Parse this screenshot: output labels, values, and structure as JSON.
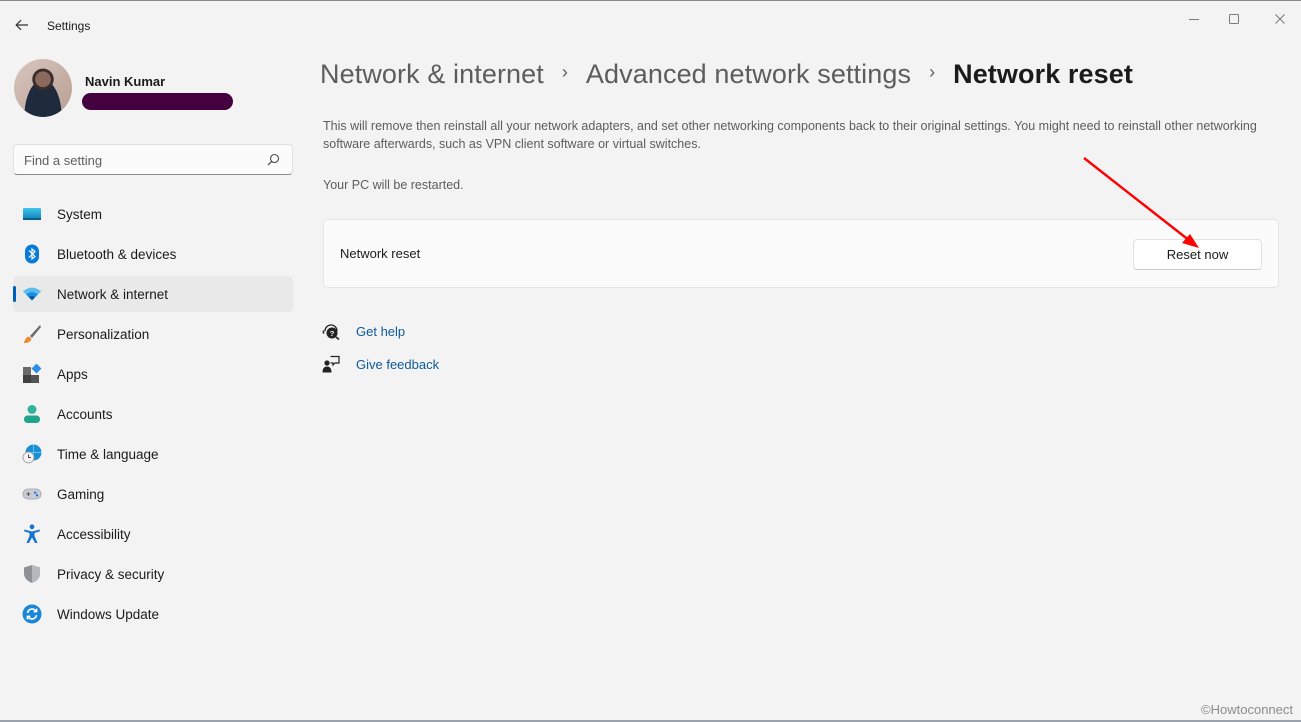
{
  "window": {
    "title": "Settings",
    "back_icon": "arrow-left-icon",
    "controls": {
      "minimize_icon": "minimize-icon",
      "maximize_icon": "maximize-icon",
      "close_icon": "close-icon"
    }
  },
  "profile": {
    "name": "Navin Kumar",
    "email_redacted": true,
    "redaction_color": "#45003f"
  },
  "search": {
    "placeholder": "Find a setting",
    "value": "",
    "icon": "search-icon"
  },
  "sidebar": {
    "accent_color": "#005fb8",
    "items": [
      {
        "label": "System",
        "icon": "system-monitor-icon",
        "active": false
      },
      {
        "label": "Bluetooth & devices",
        "icon": "bluetooth-icon",
        "active": false
      },
      {
        "label": "Network & internet",
        "icon": "wifi-icon",
        "active": true
      },
      {
        "label": "Personalization",
        "icon": "paintbrush-icon",
        "active": false
      },
      {
        "label": "Apps",
        "icon": "apps-icon",
        "active": false
      },
      {
        "label": "Accounts",
        "icon": "person-icon",
        "active": false
      },
      {
        "label": "Time & language",
        "icon": "globe-clock-icon",
        "active": false
      },
      {
        "label": "Gaming",
        "icon": "gamepad-icon",
        "active": false
      },
      {
        "label": "Accessibility",
        "icon": "accessibility-icon",
        "active": false
      },
      {
        "label": "Privacy & security",
        "icon": "shield-icon",
        "active": false
      },
      {
        "label": "Windows Update",
        "icon": "update-sync-icon",
        "active": false
      }
    ]
  },
  "main": {
    "breadcrumb": [
      {
        "label": "Network & internet"
      },
      {
        "label": "Advanced network settings"
      },
      {
        "label": "Network reset"
      }
    ],
    "breadcrumb_separator": "›",
    "description": "This will remove then reinstall all your network adapters, and set other networking components back to their original settings. You might need to reinstall other networking software afterwards, such as VPN client software or virtual switches.",
    "restart_note": "Your PC will be restarted.",
    "card": {
      "label": "Network reset",
      "button_label": "Reset now"
    },
    "links": [
      {
        "label": "Get help",
        "icon": "help-chat-icon"
      },
      {
        "label": "Give feedback",
        "icon": "feedback-icon"
      }
    ],
    "link_color": "#0f5a9c"
  },
  "annotation": {
    "arrow_color": "#ff0000",
    "points_to": "Reset now"
  },
  "watermark": "©Howtoconnect"
}
